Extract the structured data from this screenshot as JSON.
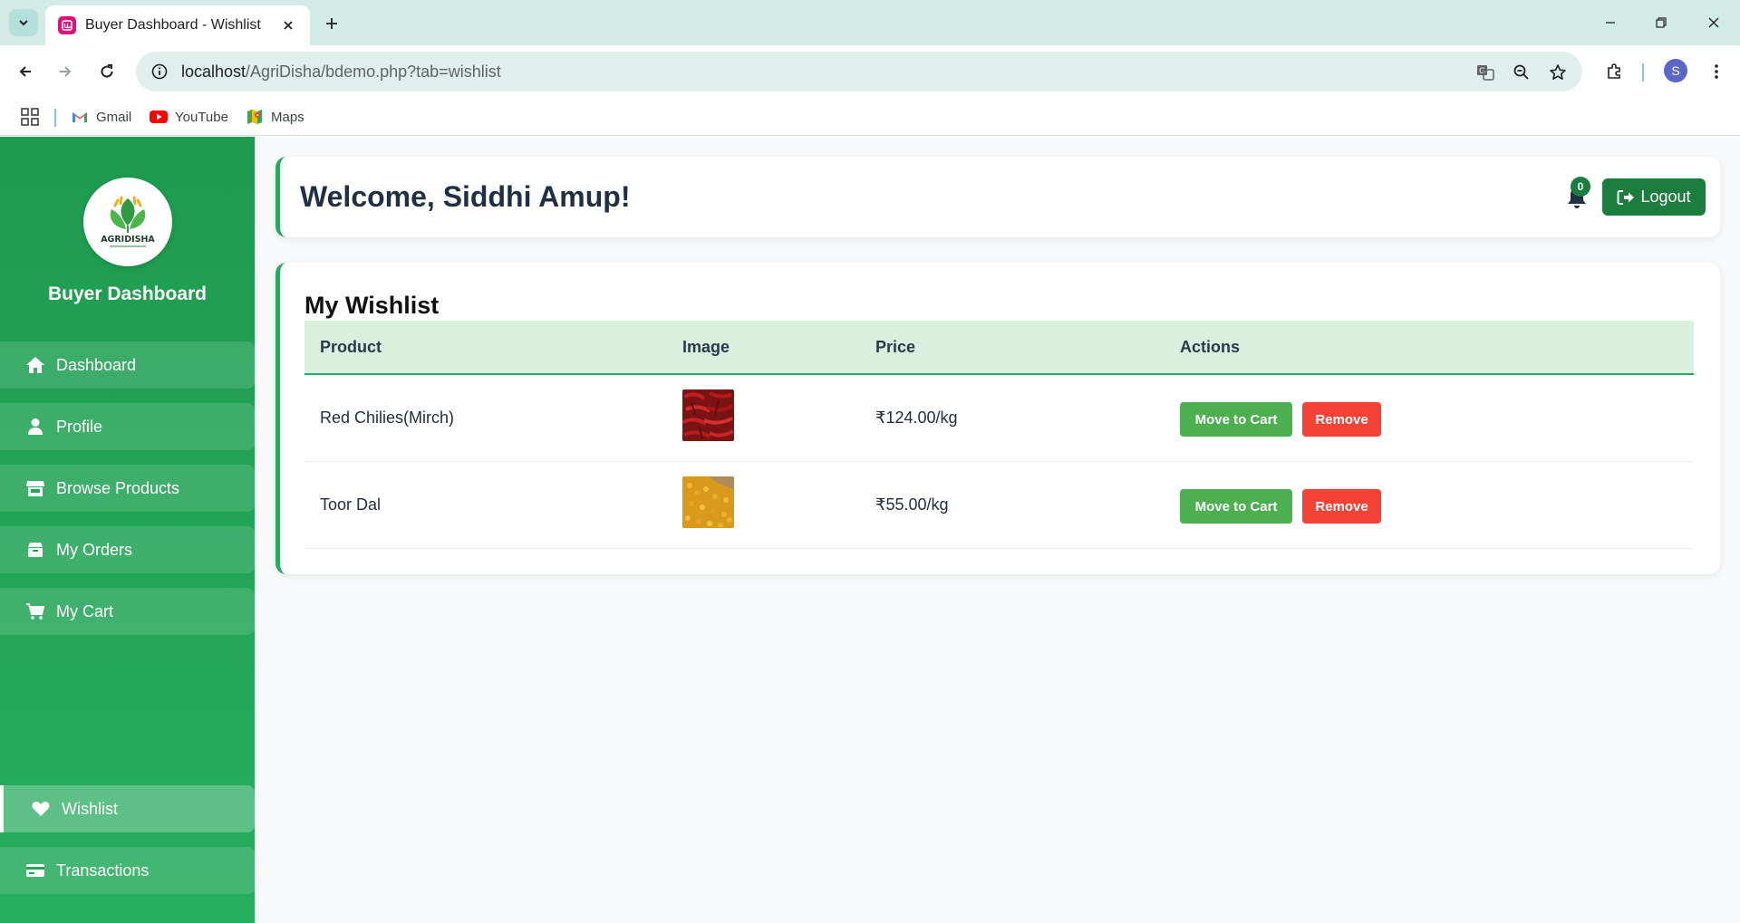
{
  "browser": {
    "tab_title": "Buyer Dashboard - Wishlist",
    "url_host": "localhost",
    "url_path": "/AgriDisha/bdemo.php?tab=wishlist",
    "bookmarks": [
      {
        "label": "Gmail",
        "icon": "gmail-icon"
      },
      {
        "label": "YouTube",
        "icon": "youtube-icon"
      },
      {
        "label": "Maps",
        "icon": "maps-icon"
      }
    ],
    "profile_initial": "S"
  },
  "sidebar": {
    "logo_text": "AGRIDISHA",
    "title": "Buyer Dashboard",
    "items": [
      {
        "label": "Dashboard",
        "icon": "home-icon"
      },
      {
        "label": "Profile",
        "icon": "user-icon"
      },
      {
        "label": "Browse Products",
        "icon": "store-icon"
      },
      {
        "label": "My Orders",
        "icon": "box-icon"
      },
      {
        "label": "My Cart",
        "icon": "cart-icon"
      },
      {
        "label": "Wishlist",
        "icon": "heart-icon",
        "active": true
      },
      {
        "label": "Transactions",
        "icon": "credit-card-icon"
      }
    ]
  },
  "header": {
    "welcome": "Welcome, Siddhi Amup!",
    "notification_count": "0",
    "logout_label": "Logout"
  },
  "wishlist": {
    "title": "My Wishlist",
    "columns": [
      "Product",
      "Image",
      "Price",
      "Actions"
    ],
    "rows": [
      {
        "product": "Red Chilies(Mirch)",
        "price": "₹124.00/kg",
        "move_label": "Move to Cart",
        "remove_label": "Remove"
      },
      {
        "product": "Toor Dal",
        "price": "₹55.00/kg",
        "move_label": "Move to Cart",
        "remove_label": "Remove"
      }
    ]
  },
  "colors": {
    "sidebar_green": "#1e9a4f",
    "accent_green": "#28a960",
    "dark_green": "#1b7e3e",
    "cart_button": "#4caf50",
    "remove_button": "#f44336"
  }
}
